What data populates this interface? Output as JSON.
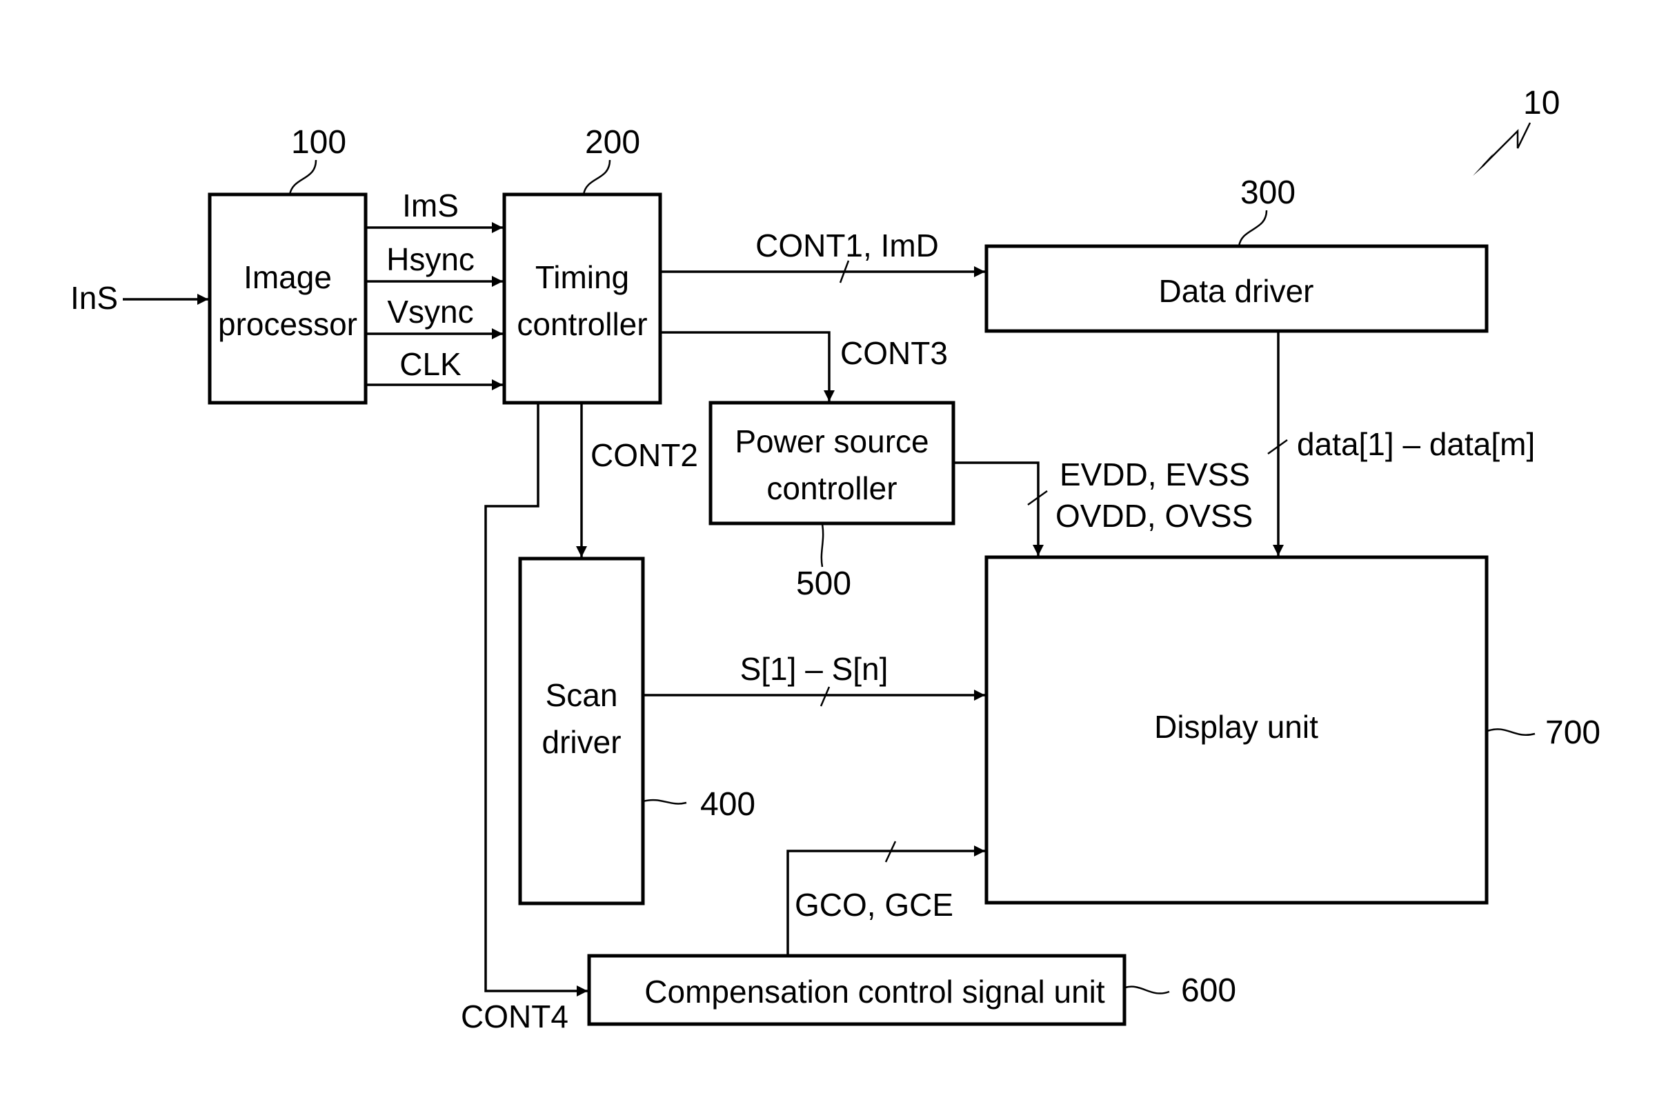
{
  "figure": {
    "ref": "10"
  },
  "blocks": {
    "image_processor": {
      "ref": "100",
      "lines": [
        "Image",
        "processor"
      ]
    },
    "timing_controller": {
      "ref": "200",
      "lines": [
        "Timing",
        "controller"
      ]
    },
    "data_driver": {
      "ref": "300",
      "lines": [
        "Data driver"
      ]
    },
    "scan_driver": {
      "ref": "400",
      "lines": [
        "Scan",
        "driver"
      ]
    },
    "power_source_controller": {
      "ref": "500",
      "lines": [
        "Power source",
        "controller"
      ]
    },
    "compensation_control_signal_unit": {
      "ref": "600",
      "lines": [
        "Compensation control signal unit"
      ]
    },
    "display_unit": {
      "ref": "700",
      "lines": [
        "Display unit"
      ]
    }
  },
  "signals": {
    "input": "InS",
    "ims": "ImS",
    "hsync": "Hsync",
    "vsync": "Vsync",
    "clk": "CLK",
    "cont1": "CONT1, ImD",
    "cont2": "CONT2",
    "cont3": "CONT3",
    "cont4": "CONT4",
    "power": [
      "EVDD, EVSS",
      "OVDD, OVSS"
    ],
    "data": "data[1] – data[m]",
    "scan": "S[1] – S[n]",
    "comp": "GCO, GCE"
  }
}
